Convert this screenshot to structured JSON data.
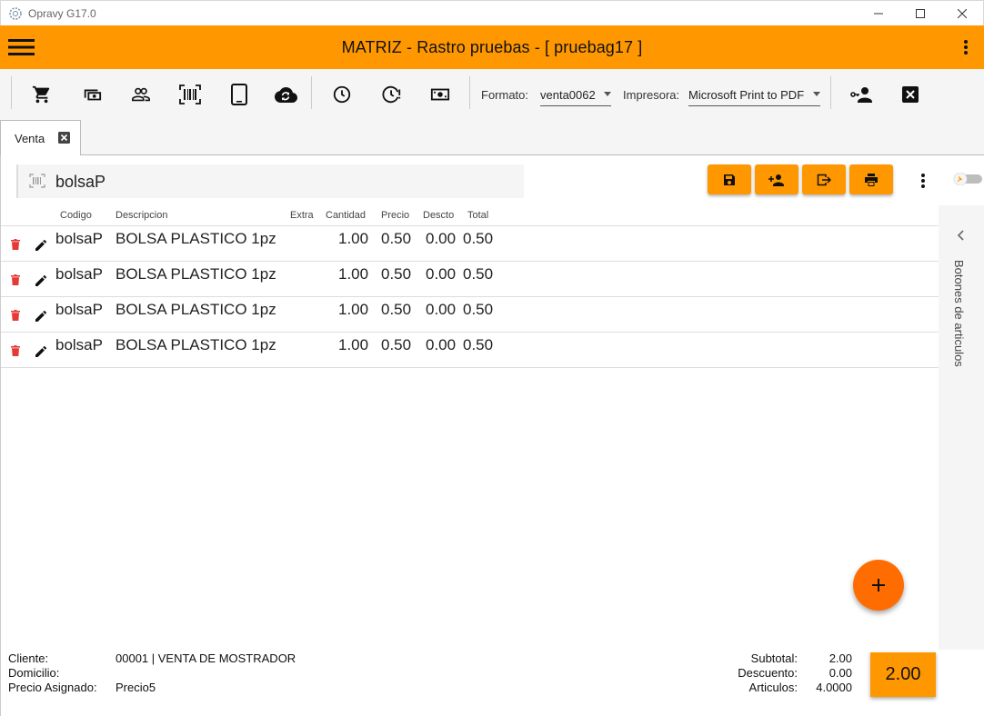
{
  "window": {
    "title": "Opravy G17.0"
  },
  "appbar": {
    "title": "MATRIZ - Rastro pruebas - [ pruebag17 ]"
  },
  "toolbar": {
    "formato_label": "Formato:",
    "formato_value": "venta0062",
    "impresora_label": "Impresora:",
    "impresora_value": "Microsoft Print to PDF"
  },
  "tabs": [
    {
      "label": "Venta"
    }
  ],
  "search": {
    "value": "bolsaP"
  },
  "grid": {
    "columns": [
      "Codigo",
      "Descripcion",
      "Extra",
      "Cantidad",
      "Precio",
      "Descto",
      "Total"
    ],
    "rows": [
      {
        "codigo": "bolsaP",
        "descripcion": "BOLSA PLASTICO 1pz",
        "extra": "",
        "cantidad": "1.00",
        "precio": "0.50",
        "descto": "0.00",
        "total": "0.50"
      },
      {
        "codigo": "bolsaP",
        "descripcion": "BOLSA PLASTICO 1pz",
        "extra": "",
        "cantidad": "1.00",
        "precio": "0.50",
        "descto": "0.00",
        "total": "0.50"
      },
      {
        "codigo": "bolsaP",
        "descripcion": "BOLSA PLASTICO 1pz",
        "extra": "",
        "cantidad": "1.00",
        "precio": "0.50",
        "descto": "0.00",
        "total": "0.50"
      },
      {
        "codigo": "bolsaP",
        "descripcion": "BOLSA PLASTICO 1pz",
        "extra": "",
        "cantidad": "1.00",
        "precio": "0.50",
        "descto": "0.00",
        "total": "0.50"
      }
    ]
  },
  "side_panel": {
    "label": "Botones de articulos"
  },
  "footer": {
    "cliente_label": "Cliente:",
    "cliente_value": "00001 | VENTA DE MOSTRADOR",
    "domicilio_label": "Domicilio:",
    "domicilio_value": "",
    "precio_label": "Precio Asignado:",
    "precio_value": "Precio5",
    "subtotal_label": "Subtotal:",
    "subtotal_value": "2.00",
    "descuento_label": "Descuento:",
    "descuento_value": "0.00",
    "articulos_label": "Articulos:",
    "articulos_value": "4.0000",
    "total_value": "2.00"
  },
  "colors": {
    "accent": "#ff9800",
    "fab": "#ff6d00",
    "delete": "#e53935"
  },
  "icons": [
    "menu-icon",
    "more-vert-icon",
    "cart-icon",
    "cash-icon",
    "people-icon",
    "barcode-icon",
    "tablet-icon",
    "cloud-sync-icon",
    "clock-icon",
    "clock-alert-icon",
    "money-icon",
    "user-key-icon",
    "close-box-icon",
    "save-icon",
    "add-user-icon",
    "exit-icon",
    "print-icon",
    "delete-icon",
    "edit-icon",
    "chevron-left-icon",
    "plus-icon",
    "pin-icon"
  ]
}
